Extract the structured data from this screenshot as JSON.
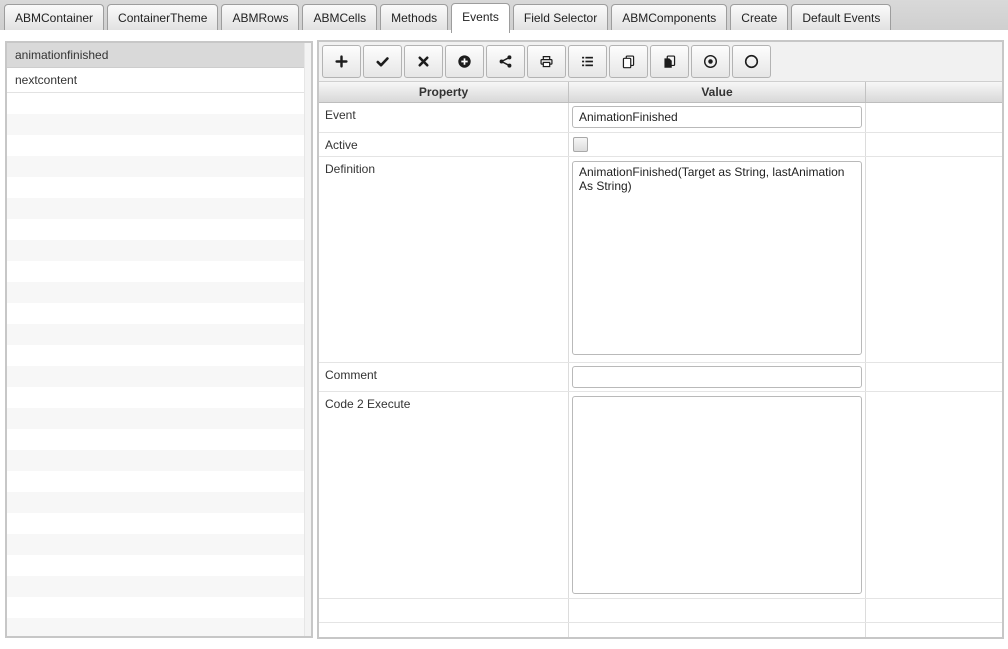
{
  "tabbar": {
    "tabs": [
      {
        "label": "ABMContainer",
        "active": false
      },
      {
        "label": "ContainerTheme",
        "active": false
      },
      {
        "label": "ABMRows",
        "active": false
      },
      {
        "label": "ABMCells",
        "active": false
      },
      {
        "label": "Methods",
        "active": false
      },
      {
        "label": "Events",
        "active": true
      },
      {
        "label": "Field Selector",
        "active": false
      },
      {
        "label": "ABMComponents",
        "active": false
      },
      {
        "label": "Create",
        "active": false
      },
      {
        "label": "Default Events",
        "active": false
      }
    ]
  },
  "event_list": {
    "items": [
      {
        "label": "animationfinished",
        "selected": true
      },
      {
        "label": "nextcontent",
        "selected": false
      }
    ]
  },
  "toolbar": {
    "buttons": [
      {
        "name": "add-button",
        "icon": "plus-icon"
      },
      {
        "name": "apply-button",
        "icon": "check-icon"
      },
      {
        "name": "delete-button",
        "icon": "x-icon"
      },
      {
        "name": "add-circle-button",
        "icon": "circle-plus-icon"
      },
      {
        "name": "share-button",
        "icon": "share-icon"
      },
      {
        "name": "print-button",
        "icon": "printer-icon"
      },
      {
        "name": "list-button",
        "icon": "list-icon"
      },
      {
        "name": "copy-button",
        "icon": "copy-icon"
      },
      {
        "name": "paste-button",
        "icon": "paste-icon"
      },
      {
        "name": "record-button",
        "icon": "circle-dot-icon"
      },
      {
        "name": "circle-button",
        "icon": "circle-icon"
      }
    ]
  },
  "property_table": {
    "headers": {
      "property": "Property",
      "value": "Value"
    },
    "rows": {
      "event": {
        "label": "Event",
        "value": "AnimationFinished"
      },
      "active": {
        "label": "Active",
        "checked": false
      },
      "definition": {
        "label": "Definition",
        "value": "AnimationFinished(Target as String, lastAnimation As String)"
      },
      "comment": {
        "label": "Comment",
        "value": ""
      },
      "code": {
        "label": "Code 2 Execute",
        "value": ""
      }
    }
  },
  "colors": {
    "tabbar_bg": "#d4d4d4",
    "selection_bg": "#d9d9d9",
    "toolbar_bg": "#f1f1f1",
    "table_header_bg": "#e0e0e0",
    "panel_border": "#c7c7c7"
  }
}
